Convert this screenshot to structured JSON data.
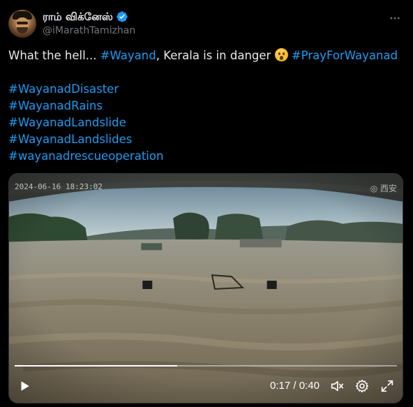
{
  "author": {
    "display_name": "ராம் விக்னேஸ்",
    "handle": "@iMarathTamizhan",
    "verified": true,
    "verified_color": "#1d9bf0"
  },
  "more_icon": "ellipsis-icon",
  "tweet": {
    "line1_prefix": "What the hell... ",
    "line1_tag1": "#Wayand",
    "line1_middle": ", Kerala is in danger ",
    "line1_emoji": "astonished-face-emoji",
    "line1_tag2": "#PrayForWayanad",
    "hashtags": [
      "#WayanadDisaster",
      "#WayanadRains",
      "#WayanadLandslide",
      "#WayanadLandslides",
      "#wayanadrescueoperation"
    ],
    "hashtag_color": "#1d9bf0"
  },
  "video": {
    "overlay_timestamp": "2024-06-16 18:23:02",
    "watermark": "◎ 西安",
    "progress": 0.425,
    "current_time": "0:17",
    "separator": " / ",
    "duration": "0:40",
    "controls": [
      "play-icon",
      "volume-muted-icon",
      "gear-icon",
      "fullscreen-icon"
    ]
  }
}
